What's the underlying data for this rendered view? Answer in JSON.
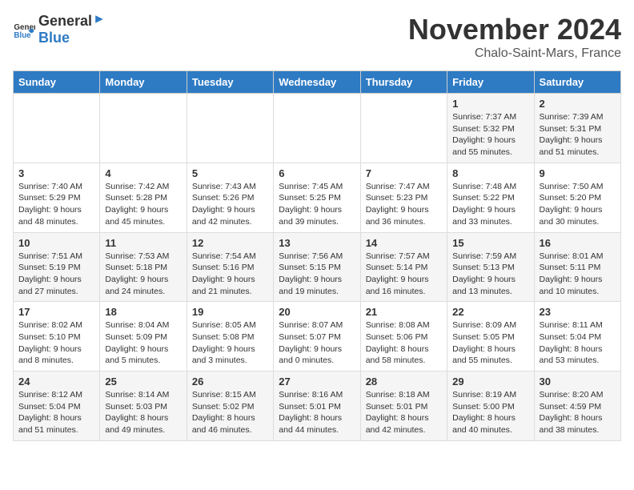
{
  "logo": {
    "general": "General",
    "blue": "Blue"
  },
  "title": "November 2024",
  "location": "Chalo-Saint-Mars, France",
  "days_header": [
    "Sunday",
    "Monday",
    "Tuesday",
    "Wednesday",
    "Thursday",
    "Friday",
    "Saturday"
  ],
  "weeks": [
    [
      {
        "day": "",
        "info": ""
      },
      {
        "day": "",
        "info": ""
      },
      {
        "day": "",
        "info": ""
      },
      {
        "day": "",
        "info": ""
      },
      {
        "day": "",
        "info": ""
      },
      {
        "day": "1",
        "info": "Sunrise: 7:37 AM\nSunset: 5:32 PM\nDaylight: 9 hours and 55 minutes."
      },
      {
        "day": "2",
        "info": "Sunrise: 7:39 AM\nSunset: 5:31 PM\nDaylight: 9 hours and 51 minutes."
      }
    ],
    [
      {
        "day": "3",
        "info": "Sunrise: 7:40 AM\nSunset: 5:29 PM\nDaylight: 9 hours and 48 minutes."
      },
      {
        "day": "4",
        "info": "Sunrise: 7:42 AM\nSunset: 5:28 PM\nDaylight: 9 hours and 45 minutes."
      },
      {
        "day": "5",
        "info": "Sunrise: 7:43 AM\nSunset: 5:26 PM\nDaylight: 9 hours and 42 minutes."
      },
      {
        "day": "6",
        "info": "Sunrise: 7:45 AM\nSunset: 5:25 PM\nDaylight: 9 hours and 39 minutes."
      },
      {
        "day": "7",
        "info": "Sunrise: 7:47 AM\nSunset: 5:23 PM\nDaylight: 9 hours and 36 minutes."
      },
      {
        "day": "8",
        "info": "Sunrise: 7:48 AM\nSunset: 5:22 PM\nDaylight: 9 hours and 33 minutes."
      },
      {
        "day": "9",
        "info": "Sunrise: 7:50 AM\nSunset: 5:20 PM\nDaylight: 9 hours and 30 minutes."
      }
    ],
    [
      {
        "day": "10",
        "info": "Sunrise: 7:51 AM\nSunset: 5:19 PM\nDaylight: 9 hours and 27 minutes."
      },
      {
        "day": "11",
        "info": "Sunrise: 7:53 AM\nSunset: 5:18 PM\nDaylight: 9 hours and 24 minutes."
      },
      {
        "day": "12",
        "info": "Sunrise: 7:54 AM\nSunset: 5:16 PM\nDaylight: 9 hours and 21 minutes."
      },
      {
        "day": "13",
        "info": "Sunrise: 7:56 AM\nSunset: 5:15 PM\nDaylight: 9 hours and 19 minutes."
      },
      {
        "day": "14",
        "info": "Sunrise: 7:57 AM\nSunset: 5:14 PM\nDaylight: 9 hours and 16 minutes."
      },
      {
        "day": "15",
        "info": "Sunrise: 7:59 AM\nSunset: 5:13 PM\nDaylight: 9 hours and 13 minutes."
      },
      {
        "day": "16",
        "info": "Sunrise: 8:01 AM\nSunset: 5:11 PM\nDaylight: 9 hours and 10 minutes."
      }
    ],
    [
      {
        "day": "17",
        "info": "Sunrise: 8:02 AM\nSunset: 5:10 PM\nDaylight: 9 hours and 8 minutes."
      },
      {
        "day": "18",
        "info": "Sunrise: 8:04 AM\nSunset: 5:09 PM\nDaylight: 9 hours and 5 minutes."
      },
      {
        "day": "19",
        "info": "Sunrise: 8:05 AM\nSunset: 5:08 PM\nDaylight: 9 hours and 3 minutes."
      },
      {
        "day": "20",
        "info": "Sunrise: 8:07 AM\nSunset: 5:07 PM\nDaylight: 9 hours and 0 minutes."
      },
      {
        "day": "21",
        "info": "Sunrise: 8:08 AM\nSunset: 5:06 PM\nDaylight: 8 hours and 58 minutes."
      },
      {
        "day": "22",
        "info": "Sunrise: 8:09 AM\nSunset: 5:05 PM\nDaylight: 8 hours and 55 minutes."
      },
      {
        "day": "23",
        "info": "Sunrise: 8:11 AM\nSunset: 5:04 PM\nDaylight: 8 hours and 53 minutes."
      }
    ],
    [
      {
        "day": "24",
        "info": "Sunrise: 8:12 AM\nSunset: 5:04 PM\nDaylight: 8 hours and 51 minutes."
      },
      {
        "day": "25",
        "info": "Sunrise: 8:14 AM\nSunset: 5:03 PM\nDaylight: 8 hours and 49 minutes."
      },
      {
        "day": "26",
        "info": "Sunrise: 8:15 AM\nSunset: 5:02 PM\nDaylight: 8 hours and 46 minutes."
      },
      {
        "day": "27",
        "info": "Sunrise: 8:16 AM\nSunset: 5:01 PM\nDaylight: 8 hours and 44 minutes."
      },
      {
        "day": "28",
        "info": "Sunrise: 8:18 AM\nSunset: 5:01 PM\nDaylight: 8 hours and 42 minutes."
      },
      {
        "day": "29",
        "info": "Sunrise: 8:19 AM\nSunset: 5:00 PM\nDaylight: 8 hours and 40 minutes."
      },
      {
        "day": "30",
        "info": "Sunrise: 8:20 AM\nSunset: 4:59 PM\nDaylight: 8 hours and 38 minutes."
      }
    ]
  ]
}
